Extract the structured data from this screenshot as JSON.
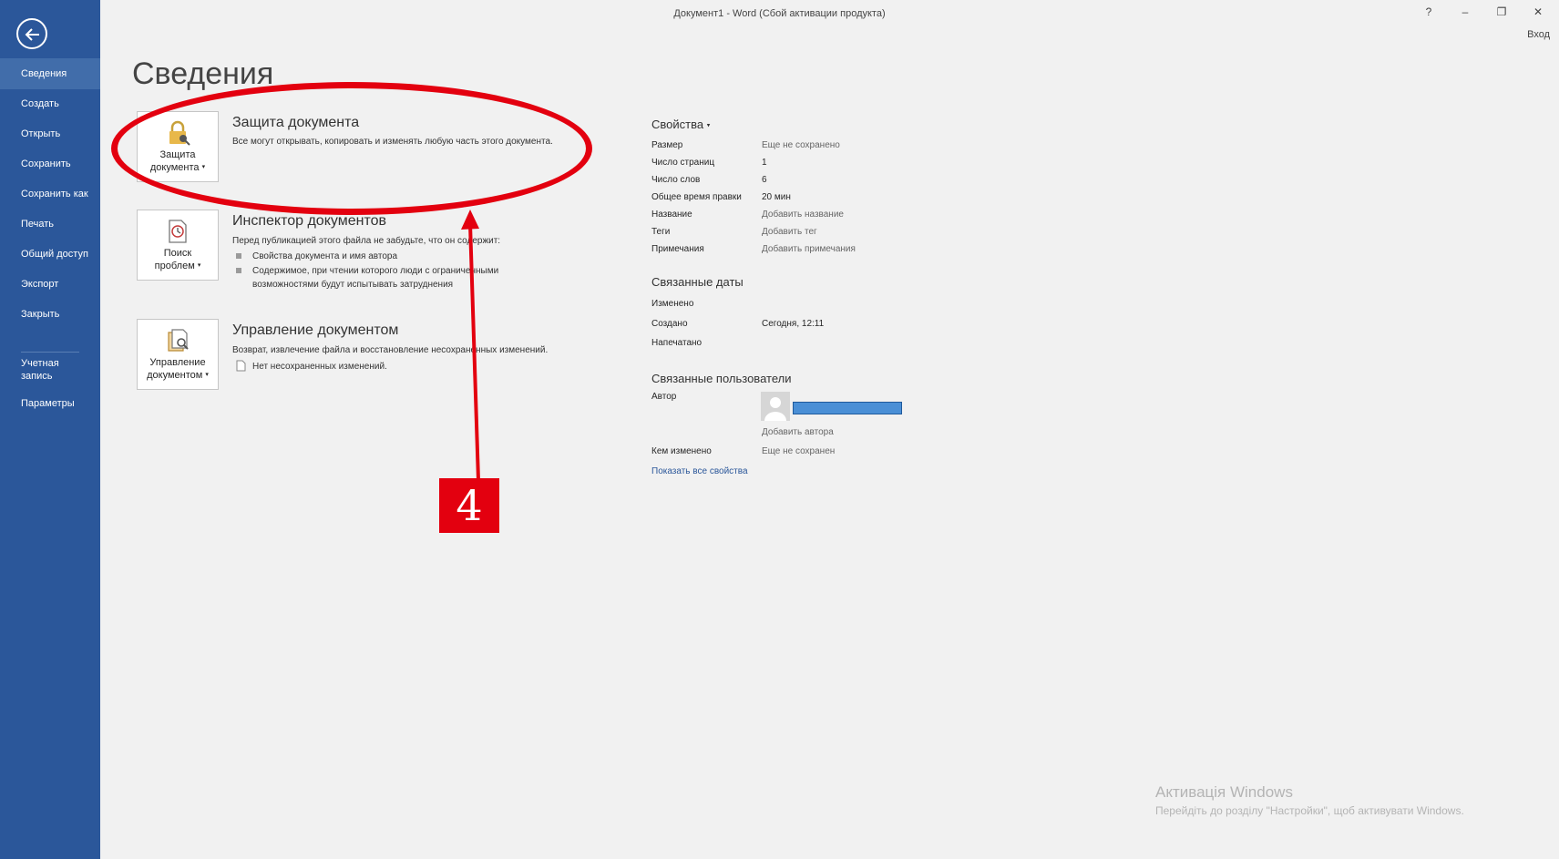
{
  "window": {
    "title": "Документ1 - Word (Сбой активации продукта)",
    "help": "?",
    "minimize": "–",
    "restore": "❐",
    "close": "✕",
    "signin": "Вход"
  },
  "sidebar": {
    "accent": "#2b579a",
    "items": [
      {
        "label": "Сведения"
      },
      {
        "label": "Создать"
      },
      {
        "label": "Открыть"
      },
      {
        "label": "Сохранить"
      },
      {
        "label": "Сохранить как"
      },
      {
        "label": "Печать"
      },
      {
        "label": "Общий доступ"
      },
      {
        "label": "Экспорт"
      },
      {
        "label": "Закрыть"
      },
      {
        "label": "Учетная\nзапись"
      },
      {
        "label": "Параметры"
      }
    ]
  },
  "page": {
    "title": "Сведения"
  },
  "protect": {
    "tile_line1": "Защита",
    "tile_line2": "документа",
    "title": "Защита документа",
    "desc": "Все могут открывать, копировать и изменять любую часть этого документа.",
    "icon": "lock-key-icon"
  },
  "inspect": {
    "tile_line1": "Поиск",
    "tile_line2": "проблем",
    "title": "Инспектор документов",
    "desc": "Перед публикацией этого файла не забудьте, что он содержит:",
    "bullets": [
      "Свойства документа и имя автора",
      "Содержимое, при чтении которого люди с ограниченными",
      "возможностями будут испытывать затруднения"
    ],
    "icon": "inspect-document-icon"
  },
  "manage": {
    "tile_line1": "Управление",
    "tile_line2": "документом",
    "title": "Управление документом",
    "desc": "Возврат, извлечение файла и восстановление несохраненных изменений.",
    "note": "Нет несохраненных изменений.",
    "icon": "manage-document-icon"
  },
  "properties": {
    "heading": "Свойства",
    "rows": [
      {
        "label": "Размер",
        "value": "Еще не сохранено"
      },
      {
        "label": "Число страниц",
        "value": "1"
      },
      {
        "label": "Число слов",
        "value": "6"
      },
      {
        "label": "Общее время правки",
        "value": "20 мин"
      },
      {
        "label": "Название",
        "value": "Добавить название"
      },
      {
        "label": "Теги",
        "value": "Добавить тег"
      },
      {
        "label": "Примечания",
        "value": "Добавить примечания"
      }
    ]
  },
  "dates": {
    "heading": "Связанные даты",
    "modified_label": "Изменено",
    "created_label": "Создано",
    "created_value": "Сегодня, 12:11",
    "printed_label": "Напечатано"
  },
  "people": {
    "heading": "Связанные пользователи",
    "author_label": "Автор",
    "add_author": "Добавить автора",
    "modified_by_label": "Кем изменено",
    "modified_by_value": "Еще не сохранен"
  },
  "show_all": "Показать все свойства",
  "annotation": {
    "number": "4",
    "color": "#e3000f"
  },
  "watermark": {
    "title": "Активація Windows",
    "subtitle": "Перейдіть до розділу \"Настройки\", щоб активувати Windows."
  }
}
